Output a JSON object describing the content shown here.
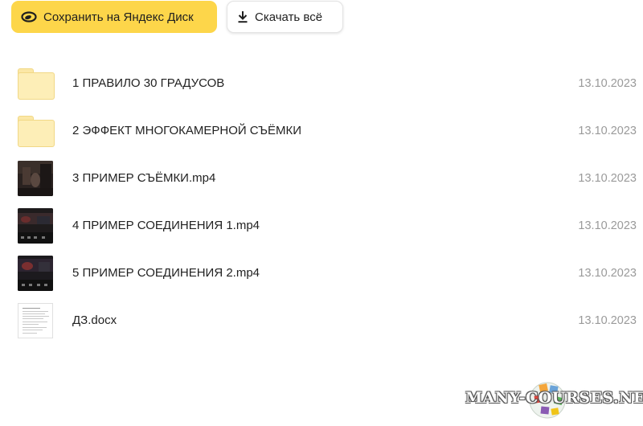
{
  "toolbar": {
    "save_label": "Сохранить на Яндекс Диск",
    "download_label": "Скачать всё"
  },
  "files": [
    {
      "name": "1 ПРАВИЛО 30 ГРАДУСОВ",
      "date": "13.10.2023",
      "type": "folder"
    },
    {
      "name": "2 ЭФФЕКТ МНОГОКАМЕРНОЙ СЪЁМКИ",
      "date": "13.10.2023",
      "type": "folder"
    },
    {
      "name": "3 ПРИМЕР СЪЁМКИ.mp4",
      "date": "13.10.2023",
      "type": "video"
    },
    {
      "name": "4 ПРИМЕР СОЕДИНЕНИЯ 1.mp4",
      "date": "13.10.2023",
      "type": "video"
    },
    {
      "name": "5 ПРИМЕР СОЕДИНЕНИЯ 2.mp4",
      "date": "13.10.2023",
      "type": "video"
    },
    {
      "name": "ДЗ.docx",
      "date": "13.10.2023",
      "type": "document"
    }
  ],
  "watermark": {
    "text": "MANY-COURSES.NET"
  },
  "colors": {
    "save_button": "#fdd64a",
    "folder": "#fdeeb7",
    "date_text": "#9a9a9a"
  },
  "icons": {
    "save": "yandex-disk-icon",
    "download": "download-icon",
    "folder": "folder-icon",
    "video": "video-thumbnail",
    "document": "document-thumbnail"
  }
}
